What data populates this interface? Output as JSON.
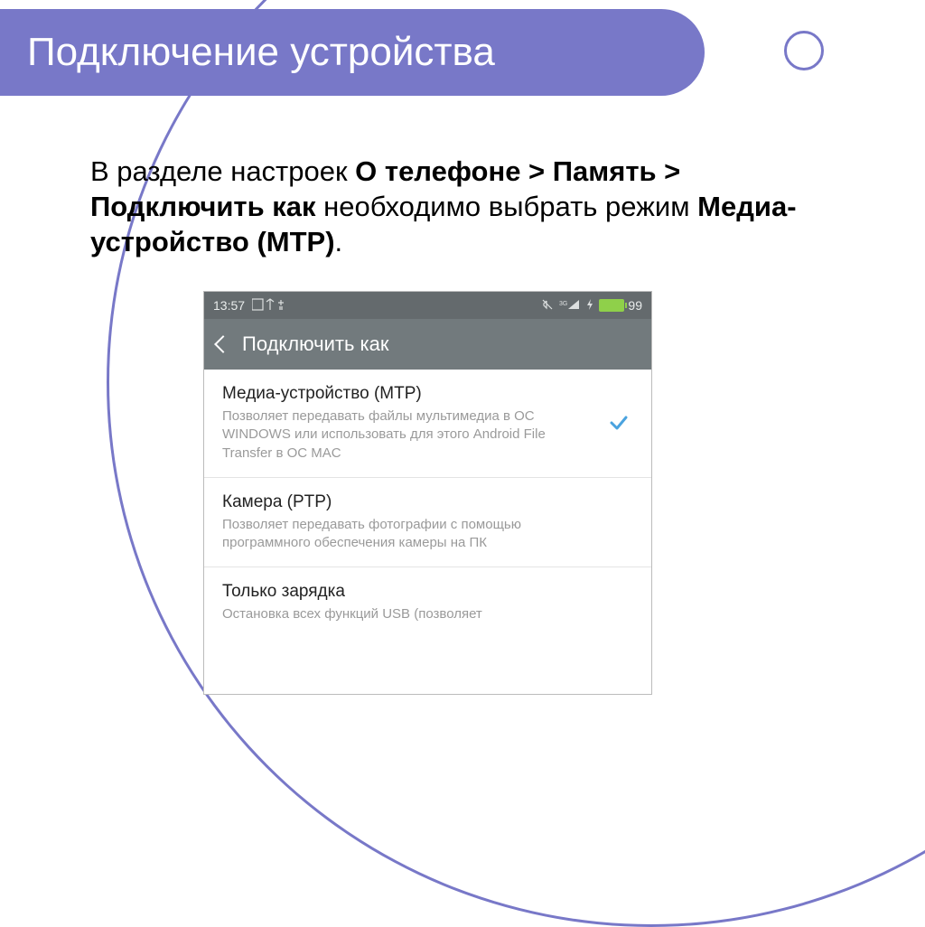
{
  "slide": {
    "title": "Подключение устройства",
    "body_prefix": "В разделе настроек ",
    "body_bold1": "О телефоне > Память > Подключить как",
    "body_mid": " необходимо выбрать режим ",
    "body_bold2": "Медиа-устройство (MTP)",
    "body_suffix": "."
  },
  "phone": {
    "status": {
      "time": "13:57",
      "icons_left": "▢ ⋔ ⎋",
      "icons_right_signal": "³ᴳ ▮◢",
      "battery_pct": "99"
    },
    "appbar": {
      "title": "Подключить как"
    },
    "options": [
      {
        "title": "Медиа-устройство (MTP)",
        "desc": "Позволяет передавать файлы мультимедиа в ОС WINDOWS или использовать для этого Android File Transfer в ОС MAC",
        "checked": true
      },
      {
        "title": "Камера (PTP)",
        "desc": "Позволяет передавать фотографии с помощью программного обеспечения камеры на ПК",
        "checked": false
      },
      {
        "title": "Только зарядка",
        "desc": "Остановка всех функций USB (позволяет",
        "checked": false
      }
    ]
  }
}
